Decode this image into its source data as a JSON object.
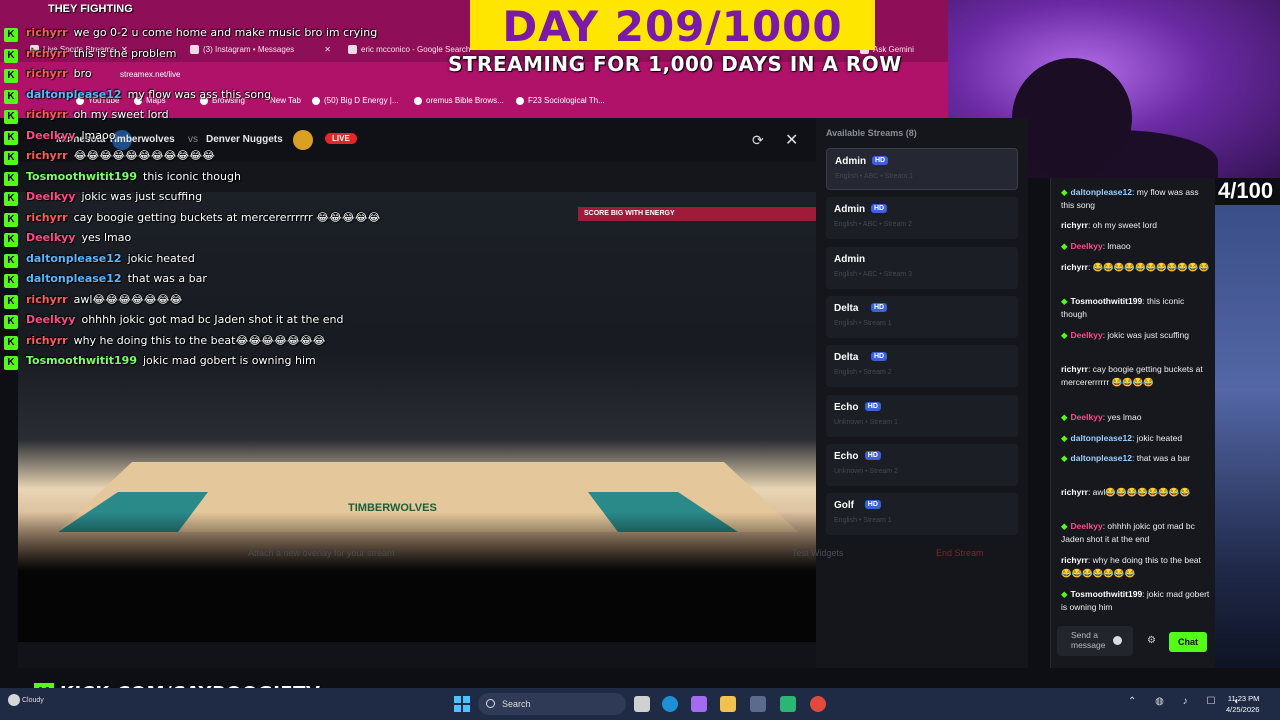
{
  "browser": {
    "tabs": [
      {
        "label": "Live Sports Streams",
        "icon_color": "#e23030"
      },
      {
        "label": "(3) Instagram • Messages",
        "icon_color": "#e1306c"
      },
      {
        "label": "eric mcconico - Google Search",
        "icon_color": "#ffffff"
      },
      {
        "label": "Ask Gemini",
        "icon_color": "#4285f4"
      }
    ],
    "url": "streamex.net/live",
    "bookmarks": [
      "YouTube",
      "Maps",
      "Browsing",
      "New Tab",
      "(50) Big D Energy |...",
      "oremus Bible Brows...",
      "F23 Sociological Th..."
    ]
  },
  "banners": {
    "day": "DAY 209/1000",
    "subtitle": "STREAMING FOR 1,000 DAYS IN A ROW",
    "counter": "4/100",
    "kick": "KICK.COM/CAYBOOGIETV",
    "kick_letter": "K"
  },
  "overlay_chat": {
    "title": "THEY FIGHTING",
    "messages": [
      {
        "user": "richyrr",
        "text": "we go 0-2 u come home and make music bro im crying",
        "color": "#ff5b5b"
      },
      {
        "user": "richyrr",
        "text": "this is the problem",
        "color": "#ff5b5b"
      },
      {
        "user": "richyrr",
        "text": "bro",
        "color": "#ff5b5b"
      },
      {
        "user": "daltonplease12",
        "text": "my flow was ass this song",
        "color": "#5bb8ff"
      },
      {
        "user": "richyrr",
        "text": "oh my sweet lord",
        "color": "#ff5b5b"
      },
      {
        "user": "Deelkyy",
        "text": "lmaoo",
        "color": "#ff4b8a"
      },
      {
        "user": "richyrr",
        "text": "😂😂😂😂😂😂😂😂😂😂😂",
        "color": "#ff5b5b"
      },
      {
        "user": "Tosmoothwitit199",
        "text": "this iconic though",
        "color": "#7bff6a"
      },
      {
        "user": "Deelkyy",
        "text": "jokic was just scuffing",
        "color": "#ff4b8a"
      },
      {
        "user": "richyrr",
        "text": "cay boogie getting buckets at mercererrrrrr 😂😂😂😂😂",
        "color": "#ff5b5b"
      },
      {
        "user": "Deelkyy",
        "text": "yes lmao",
        "color": "#ff4b8a"
      },
      {
        "user": "daltonplease12",
        "text": "jokic heated",
        "color": "#5bb8ff"
      },
      {
        "user": "daltonplease12",
        "text": "that was a bar",
        "color": "#5bb8ff"
      },
      {
        "user": "richyrr",
        "text": "awl😂😂😂😂😂😂😂",
        "color": "#ff5b5b"
      },
      {
        "user": "Deelkyy",
        "text": "ohhhh jokic got mad bc Jaden shot it at the end",
        "color": "#ff4b8a"
      },
      {
        "user": "richyrr",
        "text": "why he doing this to the beat😂😂😂😂😂😂😂",
        "color": "#ff5b5b"
      },
      {
        "user": "Tosmoothwitit199",
        "text": "jokic mad gobert is owning him",
        "color": "#7bff6a"
      }
    ]
  },
  "game": {
    "home_team": "Minnesota Timberwolves",
    "vs": "vs",
    "away_team": "Denver Nuggets",
    "live_label": "LIVE",
    "court_text": "TIMBERWOLVES",
    "ad_text": "SCORE BIG WITH ENERGY"
  },
  "streams_panel": {
    "title": "Available Streams (8)",
    "streams": [
      {
        "name": "Admin",
        "hd": "HD",
        "meta": "English • ABC • Stream 1"
      },
      {
        "name": "Admin",
        "hd": "HD",
        "meta": "English • ABC • Stream 2"
      },
      {
        "name": "Admin",
        "hd": "",
        "meta": "English • ABC • Stream 3"
      },
      {
        "name": "Delta",
        "hd": "HD",
        "meta": "English • Stream 1"
      },
      {
        "name": "Delta",
        "hd": "HD",
        "meta": "English • Stream 2"
      },
      {
        "name": "Echo",
        "hd": "HD",
        "meta": "Unknown • Stream 1"
      },
      {
        "name": "Echo",
        "hd": "HD",
        "meta": "Unknown • Stream 2"
      },
      {
        "name": "Golf",
        "hd": "HD",
        "meta": "English • Stream 1"
      }
    ]
  },
  "bottom_bar": {
    "hint": "Attach a new overlay for your stream",
    "test_widgets": "Test Widgets",
    "end_stream": "End Stream"
  },
  "chat_panel": {
    "messages": [
      {
        "user": "daltonplease12",
        "text": "my flow was ass this song",
        "badge": true,
        "color": "#9ad0ff"
      },
      {
        "user": "richyrr",
        "text": "oh my sweet lord",
        "badge": false,
        "color": "#ffffff"
      },
      {
        "user": "Deelkyy",
        "text": "lmaoo",
        "badge": true,
        "color": "#ff4b8a"
      },
      {
        "user": "richyrr",
        "text": "😂😂😂😂😂😂😂😂😂😂😂",
        "badge": false,
        "color": "#ffffff"
      },
      {
        "user": "Tosmoothwitit199",
        "text": "this iconic though",
        "badge": true,
        "color": "#ffffff"
      },
      {
        "user": "Deelkyy",
        "text": "jokic was just scuffing",
        "badge": true,
        "color": "#ff4b8a"
      },
      {
        "user": "richyrr",
        "text": "cay boogie getting buckets at mercererrrrrr 😂😂😂😂",
        "badge": false,
        "color": "#ffffff"
      },
      {
        "user": "Deelkyy",
        "text": "yes lmao",
        "badge": true,
        "color": "#ff4b8a"
      },
      {
        "user": "daltonplease12",
        "text": "jokic heated",
        "badge": true,
        "color": "#9ad0ff"
      },
      {
        "user": "daltonplease12",
        "text": "that was a bar",
        "badge": true,
        "color": "#9ad0ff"
      },
      {
        "user": "richyrr",
        "text": "awl😂😂😂😂😂😂😂😂",
        "badge": false,
        "color": "#ffffff"
      },
      {
        "user": "Deelkyy",
        "text": "ohhhh jokic got mad bc Jaden shot it at the end",
        "badge": true,
        "color": "#ff4b8a"
      },
      {
        "user": "richyrr",
        "text": "why he doing this to the beat😂😂😂😂😂😂😂",
        "badge": false,
        "color": "#ffffff"
      },
      {
        "user": "Tosmoothwitit199",
        "text": "jokic mad gobert is owning him",
        "badge": true,
        "color": "#ffffff"
      }
    ],
    "input_placeholder": "Send a message",
    "send_label": "Chat"
  },
  "taskbar": {
    "weather": "Cloudy",
    "search": "Search",
    "time": "11:23 PM",
    "date": "4/25/2026"
  }
}
